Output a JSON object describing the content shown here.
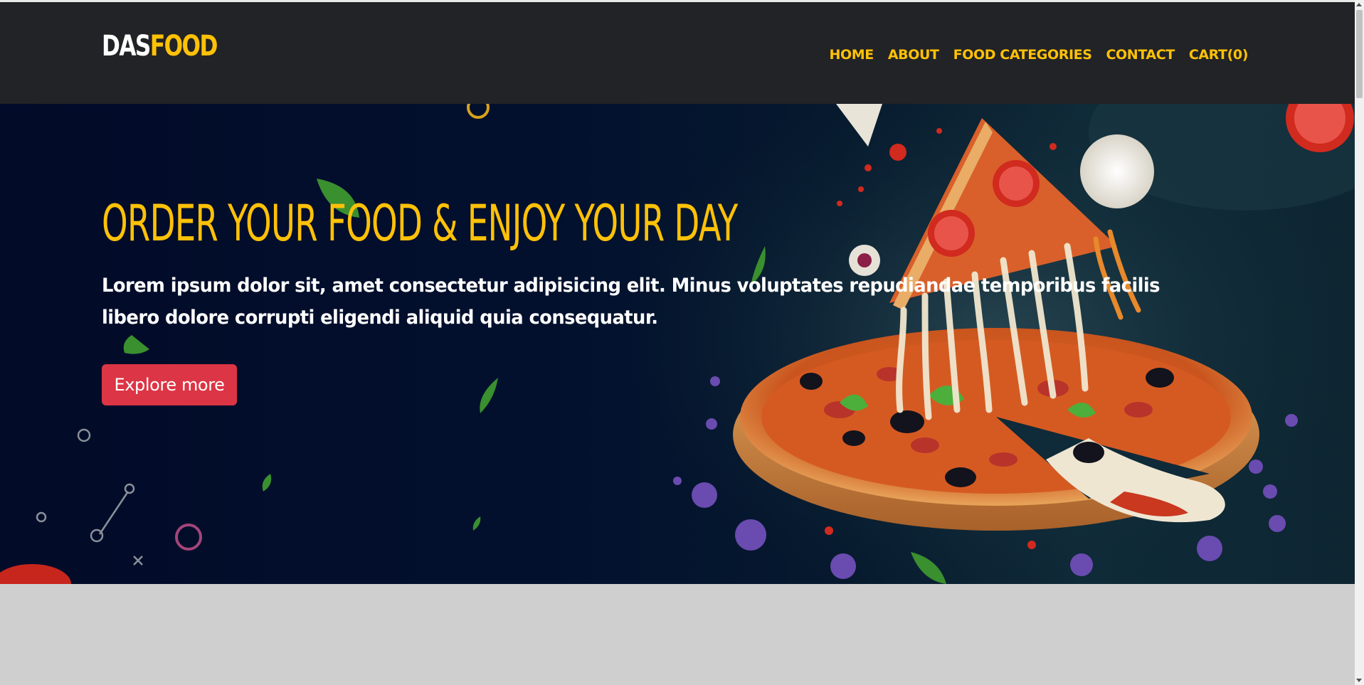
{
  "brand": {
    "part1": "DAS",
    "part2": "FOOD"
  },
  "nav": {
    "items": [
      {
        "label": "HOME"
      },
      {
        "label": "ABOUT"
      },
      {
        "label": "FOOD CATEGORIES"
      },
      {
        "label": "CONTACT"
      },
      {
        "label": "CART(0)"
      }
    ]
  },
  "hero": {
    "title": "ORDER YOUR FOOD & ENJOY YOUR DAY",
    "text": "Lorem ipsum dolor sit, amet consectetur adipisicing elit. Minus voluptates repudiandae temporibus facilis libero dolore corrupti eligendi aliquid quia consequatur.",
    "button_label": "Explore more",
    "image_subject": "pizza-with-cheese-pull"
  },
  "colors": {
    "header_bg": "#222326",
    "accent": "#ffc107",
    "button": "#dc3545",
    "hero_bg": "#020b28",
    "page_bg": "#cfcfcf"
  }
}
